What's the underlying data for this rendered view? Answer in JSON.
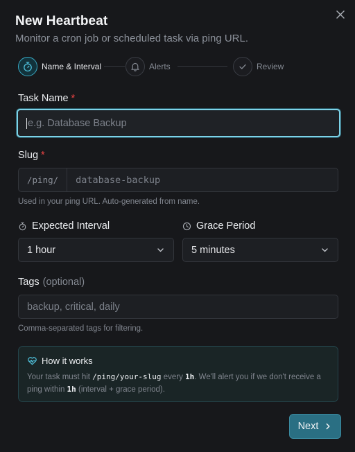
{
  "dialog": {
    "title": "New Heartbeat",
    "subtitle": "Monitor a cron job or scheduled task via ping URL."
  },
  "stepper": {
    "steps": [
      {
        "label": "Name & Interval",
        "icon": "stopwatch-icon",
        "active": true
      },
      {
        "label": "Alerts",
        "icon": "bell-icon",
        "active": false
      },
      {
        "label": "Review",
        "icon": "check-icon",
        "active": false
      }
    ]
  },
  "fields": {
    "task_name": {
      "label": "Task Name",
      "required_mark": "*",
      "value": "",
      "placeholder": "e.g. Database Backup"
    },
    "slug": {
      "label": "Slug",
      "required_mark": "*",
      "prefix": "/ping/",
      "placeholder": "database-backup",
      "hint": "Used in your ping URL. Auto-generated from name."
    },
    "interval": {
      "label": "Expected Interval",
      "value": "1 hour",
      "icon": "stopwatch-icon"
    },
    "grace": {
      "label": "Grace Period",
      "value": "5 minutes",
      "icon": "clock-icon"
    },
    "tags": {
      "label": "Tags",
      "optional_text": "(optional)",
      "placeholder": "backup, critical, daily",
      "hint": "Comma-separated tags for filtering."
    }
  },
  "info": {
    "title": "How it works",
    "icon": "heart-pulse-icon",
    "text_1": "Your task must hit ",
    "code": "/ping/your-slug",
    "text_2": " every ",
    "interval_value": "1h",
    "text_3": ". We'll alert you if we don't receive a ping within ",
    "window_value": "1h",
    "text_4": " (interval + grace period)."
  },
  "actions": {
    "next_label": "Next"
  },
  "colors": {
    "accent": "#38a8c3",
    "background": "#17181b",
    "required": "#ef4444",
    "button": "#2a6f83"
  }
}
